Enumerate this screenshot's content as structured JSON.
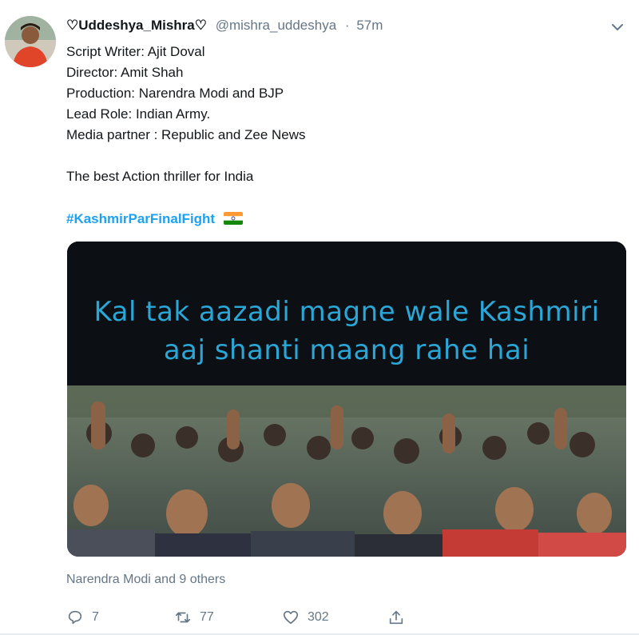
{
  "tweet": {
    "display_name": "♡Uddeshya_Mishra♡",
    "handle": "@mishra_uddeshya",
    "separator": "·",
    "time": "57m",
    "lines": [
      "Script Writer: Ajit Doval",
      "Director: Amit Shah",
      "Production: Narendra Modi and BJP",
      "Lead Role: Indian Army.",
      "Media partner : Republic and Zee News"
    ],
    "tagline": "The best Action thriller for India",
    "hashtag": "#KashmirParFinalFight",
    "flag_icon": "india-flag-icon",
    "media": {
      "caption_line1": "Kal tak aazadi magne wale Kashmiri",
      "caption_line2": "aaj shanti maang rahe hai",
      "caption_color": "#2aa7d7"
    },
    "liked_by": "Narendra Modi and 9 others",
    "actions": {
      "reply_count": "7",
      "retweet_count": "77",
      "like_count": "302"
    }
  },
  "colors": {
    "accent": "#1da1f2",
    "secondary_text": "#657786",
    "primary_text": "#14171a"
  }
}
